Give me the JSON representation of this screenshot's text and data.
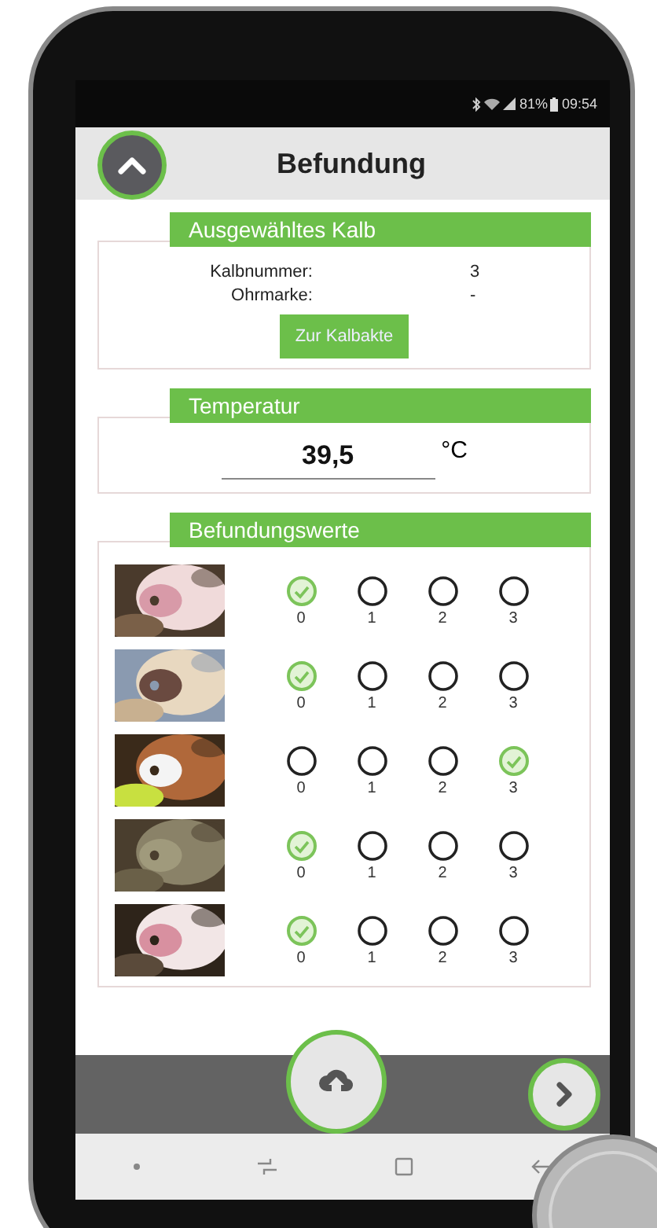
{
  "status_bar": {
    "battery": "81%",
    "time": "09:54"
  },
  "header": {
    "title": "Befundung"
  },
  "calf": {
    "heading": "Ausgewähltes Kalb",
    "fields": [
      {
        "label": "Kalbnummer:",
        "value": "3"
      },
      {
        "label": "Ohrmarke:",
        "value": "-"
      }
    ],
    "button": "Zur Kalbakte"
  },
  "temperature": {
    "heading": "Temperatur",
    "value": "39,5",
    "unit": "°C"
  },
  "findings": {
    "heading": "Befundungswerte",
    "rows": [
      {
        "options": [
          {
            "label": "0",
            "selected": true
          },
          {
            "label": "1",
            "selected": false
          },
          {
            "label": "2",
            "selected": false
          },
          {
            "label": "3",
            "selected": false
          }
        ]
      },
      {
        "options": [
          {
            "label": "0",
            "selected": true
          },
          {
            "label": "1",
            "selected": false
          },
          {
            "label": "2",
            "selected": false
          },
          {
            "label": "3",
            "selected": false
          }
        ]
      },
      {
        "options": [
          {
            "label": "0",
            "selected": false
          },
          {
            "label": "1",
            "selected": false
          },
          {
            "label": "2",
            "selected": false
          },
          {
            "label": "3",
            "selected": true
          }
        ]
      },
      {
        "options": [
          {
            "label": "0",
            "selected": true
          },
          {
            "label": "1",
            "selected": false
          },
          {
            "label": "2",
            "selected": false
          },
          {
            "label": "3",
            "selected": false
          }
        ]
      },
      {
        "options": [
          {
            "label": "0",
            "selected": true
          },
          {
            "label": "1",
            "selected": false
          },
          {
            "label": "2",
            "selected": false
          },
          {
            "label": "3",
            "selected": false
          }
        ]
      }
    ]
  }
}
